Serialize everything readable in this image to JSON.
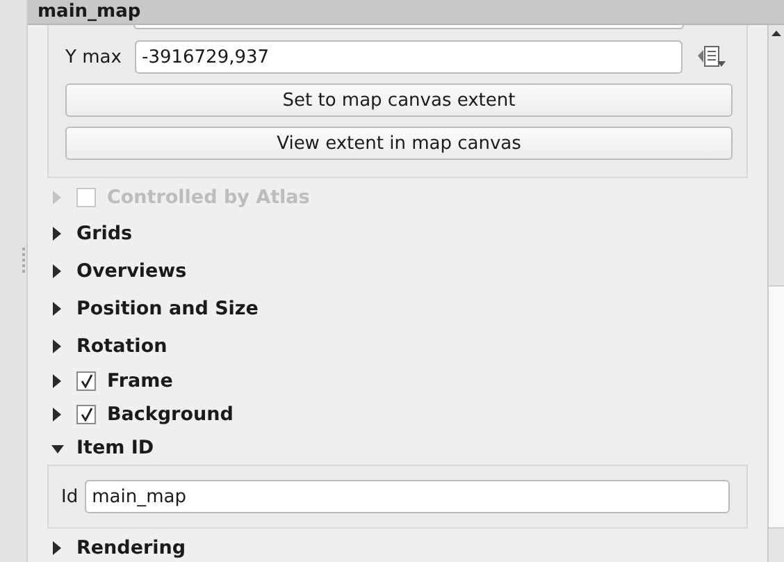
{
  "panel_title": "main_map",
  "extent": {
    "y_max_label": "Y max",
    "y_max_value": "-3916729,937",
    "buttons": [
      "Set to map canvas extent",
      "View extent in map canvas"
    ]
  },
  "sections": [
    {
      "label": "Controlled by Atlas",
      "kind": "check",
      "checked": false,
      "disabled": true,
      "expanded": false
    },
    {
      "label": "Grids",
      "kind": "plain",
      "disabled": false,
      "expanded": false
    },
    {
      "label": "Overviews",
      "kind": "plain",
      "disabled": false,
      "expanded": false
    },
    {
      "label": "Position and Size",
      "kind": "plain",
      "disabled": false,
      "expanded": false
    },
    {
      "label": "Rotation",
      "kind": "plain",
      "disabled": false,
      "expanded": false
    },
    {
      "label": "Frame",
      "kind": "check",
      "checked": true,
      "disabled": false,
      "expanded": false
    },
    {
      "label": "Background",
      "kind": "check",
      "checked": true,
      "disabled": false,
      "expanded": false
    },
    {
      "label": "Item ID",
      "kind": "plain",
      "disabled": false,
      "expanded": true,
      "fields": [
        {
          "label": "Id",
          "value": "main_map"
        }
      ]
    },
    {
      "label": "Rendering",
      "kind": "plain",
      "disabled": false,
      "expanded": false
    }
  ]
}
